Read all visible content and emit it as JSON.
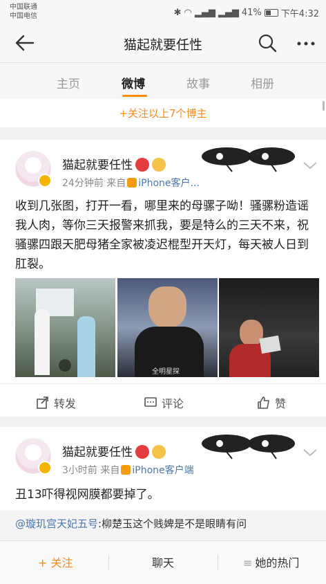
{
  "status": {
    "carrier1": "中国联通",
    "carrier2": "中国电信",
    "battery": "41%",
    "time": "下午4:32"
  },
  "nav": {
    "title": "猫起就要任性"
  },
  "tabs": [
    {
      "label": "主页"
    },
    {
      "label": "微博"
    },
    {
      "label": "故事"
    },
    {
      "label": "相册"
    }
  ],
  "follow_strip": "+关注以上7个博主",
  "posts": [
    {
      "username": "猫起就要任性",
      "time": "24分钟前",
      "from_label": "来自",
      "source": "iPhone客户...",
      "text": "收到几张图，打开一看，哪里来的母骡子呦！骚骡粉造谣我人肉，等你三天报警来抓我，要是特么的三天不来，祝骚骡四跟天肥母猪全家被凌迟棍型开天灯，每天被人日到肛裂。",
      "photo2_watermark": "全明星探",
      "actions": {
        "repost": "转发",
        "comment": "评论",
        "like": "赞"
      }
    },
    {
      "username": "猫起就要任性",
      "time": "3小时前",
      "from_label": "来自",
      "source": "iPhone客户端",
      "text": "丑13吓得视网膜都要掉了。",
      "repost_user": "@璇玑宫天妃五号",
      "repost_text": ":柳楚玉这个贱婢是不是眼睛有问"
    }
  ],
  "bottom": {
    "follow": "+ 关注",
    "chat": "聊天",
    "hot": "她的热门",
    "hot_icon": "≡"
  },
  "colors": {
    "accent": "#f58b1b",
    "link": "#4b77a9"
  }
}
